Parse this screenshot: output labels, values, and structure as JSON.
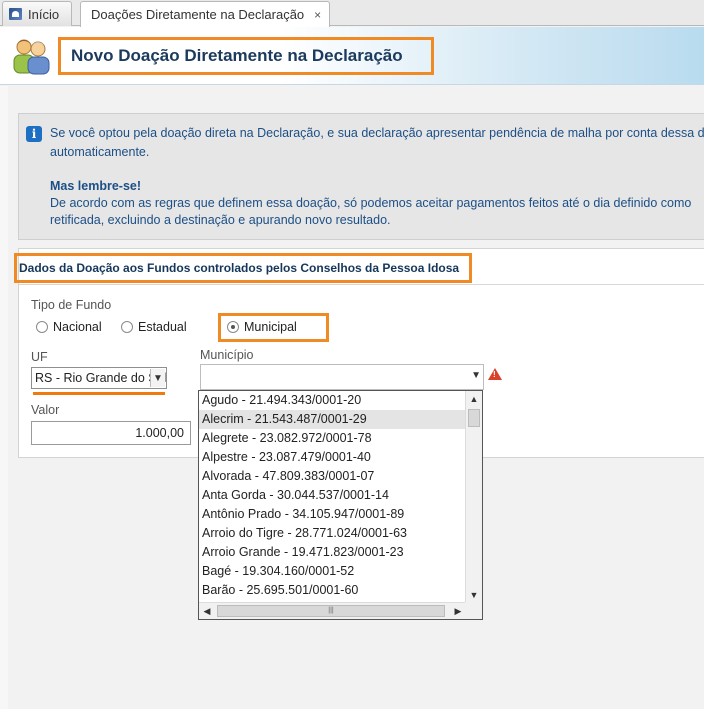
{
  "tabs": {
    "home_label": "Início",
    "active_label": "Doações Diretamente na Declaração",
    "close_glyph": "×"
  },
  "header": {
    "title": "Novo Doação Diretamente na Declaração"
  },
  "info": {
    "line1": "Se você optou pela doação direta na Declaração, e sua declaração apresentar pendência de malha por conta dessa d",
    "line2": "automaticamente.",
    "bold": "Mas lembre-se!",
    "line3": "De acordo com as regras que definem essa doação, só podemos aceitar pagamentos feitos até o dia definido como",
    "line4": "retificada, excluindo a destinação e apurando novo resultado."
  },
  "form": {
    "section_title": "Dados da Doação aos Fundos controlados pelos Conselhos da Pessoa Idosa",
    "tipo_label": "Tipo de Fundo",
    "radios": {
      "nacional": "Nacional",
      "estadual": "Estadual",
      "municipal": "Municipal"
    },
    "uf_label": "UF",
    "uf_value": "RS - Rio Grande do Sul",
    "municipio_label": "Município",
    "valor_label": "Valor",
    "valor_value": "1.000,00"
  },
  "municipios": [
    "Agudo - 21.494.343/0001-20",
    "Alecrim - 21.543.487/0001-29",
    "Alegrete - 23.082.972/0001-78",
    "Alpestre - 23.087.479/0001-40",
    "Alvorada - 47.809.383/0001-07",
    "Anta Gorda - 30.044.537/0001-14",
    "Antônio Prado - 34.105.947/0001-89",
    "Arroio do Tigre - 28.771.024/0001-63",
    "Arroio Grande - 19.471.823/0001-23",
    "Bagé - 19.304.160/0001-52",
    "Barão - 25.695.501/0001-60"
  ],
  "colors": {
    "highlight": "#f08a24",
    "title_blue": "#1b3a5c",
    "info_blue": "#1c4f86"
  }
}
